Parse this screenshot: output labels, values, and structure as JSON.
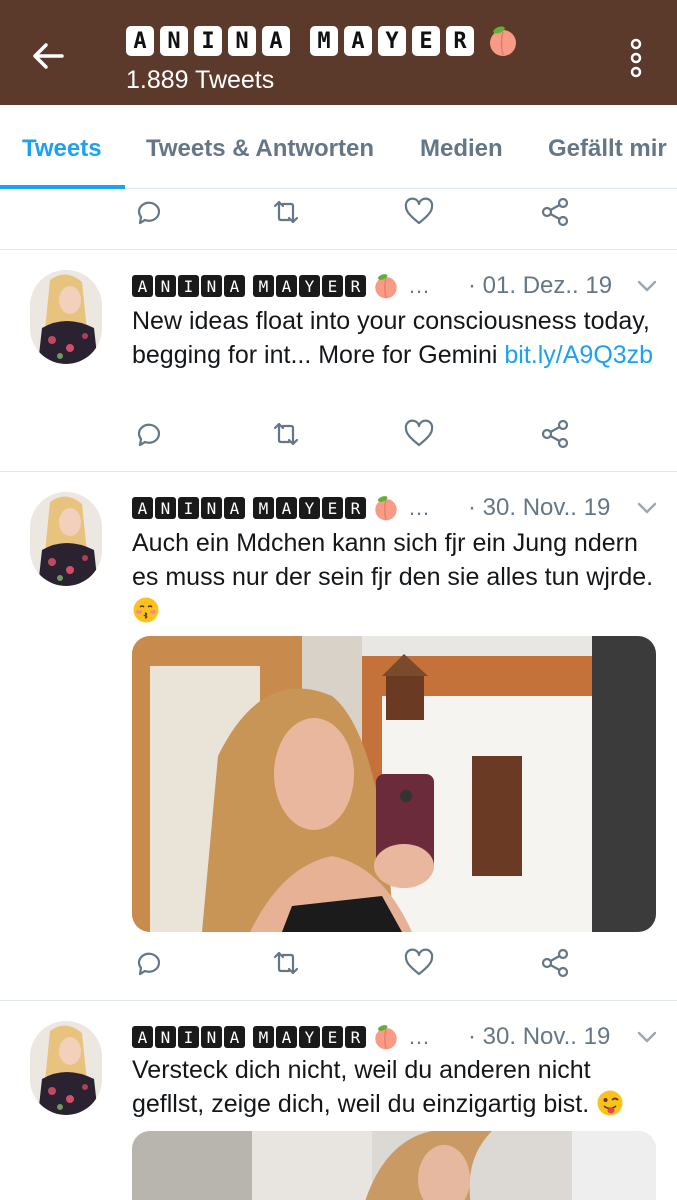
{
  "header": {
    "name_letters_1": [
      "A",
      "N",
      "I",
      "N",
      "A"
    ],
    "name_letters_2": [
      "M",
      "A",
      "Y",
      "E",
      "R"
    ],
    "tweet_count": "1.889 Tweets",
    "back_icon": "arrow-left-icon",
    "menu_icon": "more-vertical-icon",
    "name_emoji": "peach-icon"
  },
  "tabs": [
    {
      "label": "Tweets",
      "active": true
    },
    {
      "label": "Tweets & Antworten",
      "active": false
    },
    {
      "label": "Medien",
      "active": false
    },
    {
      "label": "Gefällt mir",
      "active": false
    }
  ],
  "action_icons": [
    "reply-icon",
    "retweet-icon",
    "like-icon",
    "share-icon"
  ],
  "tweets": [
    {
      "ellipsis": "…",
      "date": "· 01. Dez.. 19",
      "text_1": "New ideas float into your consciousness today, begging for int... More for Gemini ",
      "link": "bit.ly/A9Q3zb"
    },
    {
      "ellipsis": "…",
      "date": "· 30. Nov.. 19",
      "text_1": "Auch ein Mdchen kann sich fjr ein Jung ndern es muss nur der sein fjr den sie alles tun wjrde. ",
      "emoji": "kissing-face-icon",
      "media": "selfie-photo"
    },
    {
      "ellipsis": "…",
      "date": "· 30. Nov.. 19",
      "text_1": "Versteck dich nicht, weil du anderen nicht gefllst, zeige dich, weil du einzigartig bist. ",
      "emoji": "winking-tongue-face-icon",
      "media": "selfie-photo"
    }
  ],
  "colors": {
    "header_bg": "#5b3a2c",
    "accent": "#1da1f2",
    "secondary_text": "#657786",
    "divider": "#e1e8ed"
  }
}
